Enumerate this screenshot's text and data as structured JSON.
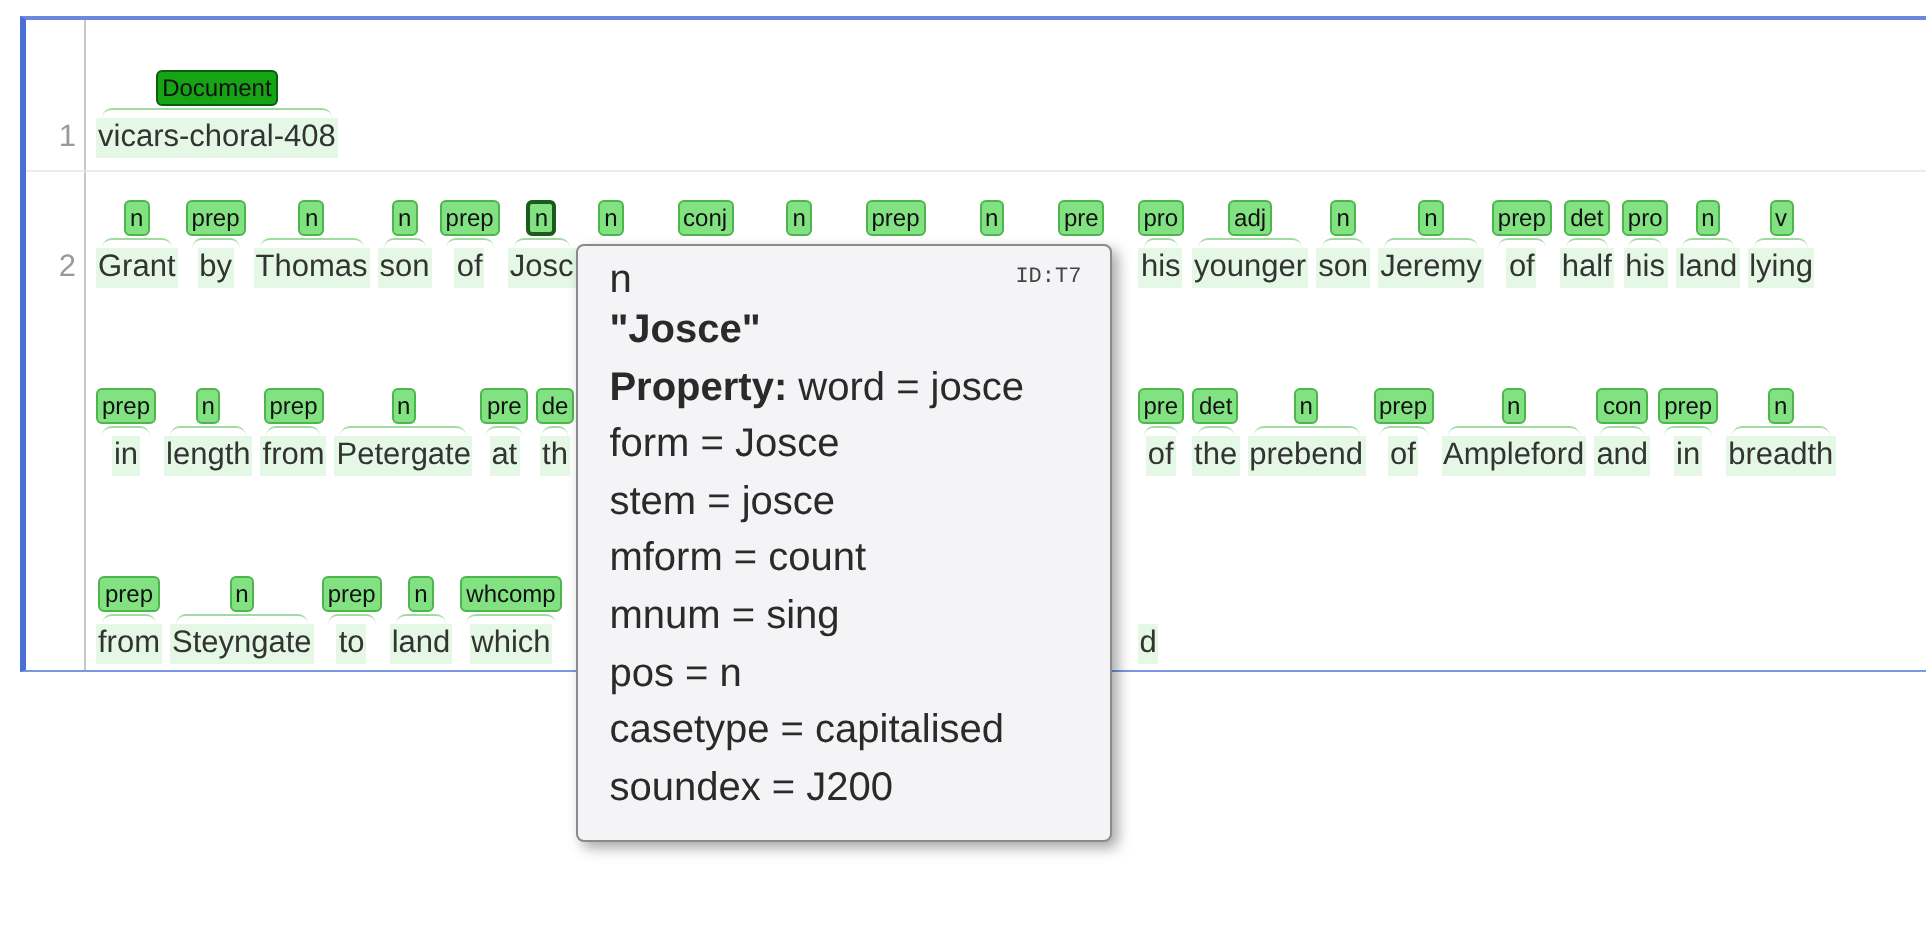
{
  "lines": [
    {
      "number": "1",
      "left": [
        {
          "kind": "document",
          "label": "Document",
          "word": "vicars-choral-408",
          "selected": false
        }
      ]
    },
    {
      "number": "2",
      "left": [
        {
          "kind": "span",
          "label": "n",
          "word": "Grant",
          "selected": false
        },
        {
          "kind": "span",
          "label": "prep",
          "word": "by",
          "selected": false
        },
        {
          "kind": "span",
          "label": "n",
          "word": "Thomas",
          "selected": false
        },
        {
          "kind": "span",
          "label": "n",
          "word": "son",
          "selected": false
        },
        {
          "kind": "span",
          "label": "prep",
          "word": "of",
          "selected": false
        },
        {
          "kind": "span",
          "label": "n",
          "word": "Josc",
          "selected": true
        }
      ],
      "covered": [
        {
          "kind": "span",
          "label": "n",
          "selected": false
        },
        {
          "kind": "span",
          "label": "conj",
          "selected": false
        },
        {
          "kind": "span",
          "label": "n",
          "selected": false
        },
        {
          "kind": "span",
          "label": "prep",
          "selected": false
        },
        {
          "kind": "span",
          "label": "n",
          "selected": false
        },
        {
          "kind": "span",
          "label": "pre",
          "selected": false
        }
      ],
      "right": [
        {
          "kind": "span",
          "label": "pro",
          "word": "his",
          "selected": false
        },
        {
          "kind": "span",
          "label": "adj",
          "word": "younger",
          "selected": false
        },
        {
          "kind": "span",
          "label": "n",
          "word": "son",
          "selected": false
        },
        {
          "kind": "span",
          "label": "n",
          "word": "Jeremy",
          "selected": false
        },
        {
          "kind": "span",
          "label": "prep",
          "word": "of",
          "selected": false
        },
        {
          "kind": "span",
          "label": "det",
          "word": "half",
          "selected": false
        },
        {
          "kind": "span",
          "label": "pro",
          "word": "his",
          "selected": false
        },
        {
          "kind": "span",
          "label": "n",
          "word": "land",
          "selected": false
        },
        {
          "kind": "span",
          "label": "v",
          "word": "lying",
          "selected": false
        }
      ]
    },
    {
      "left": [
        {
          "kind": "span",
          "label": "prep",
          "word": "in",
          "selected": false
        },
        {
          "kind": "span",
          "label": "n",
          "word": "length",
          "selected": false
        },
        {
          "kind": "span",
          "label": "prep",
          "word": "from",
          "selected": false
        },
        {
          "kind": "span",
          "label": "n",
          "word": "Petergate",
          "selected": false
        },
        {
          "kind": "span",
          "label": "pre",
          "word": "at",
          "selected": false
        },
        {
          "kind": "span",
          "label": "de",
          "word": "th",
          "selected": false
        }
      ],
      "right": [
        {
          "kind": "span",
          "label": "pre",
          "word": "of",
          "selected": false
        },
        {
          "kind": "span",
          "label": "det",
          "word": "the",
          "selected": false
        },
        {
          "kind": "span",
          "label": "n",
          "word": "prebend",
          "selected": false
        },
        {
          "kind": "span",
          "label": "prep",
          "word": "of",
          "selected": false
        },
        {
          "kind": "span",
          "label": "n",
          "word": "Ampleford",
          "selected": false
        },
        {
          "kind": "span",
          "label": "con",
          "word": "and",
          "selected": false
        },
        {
          "kind": "span",
          "label": "prep",
          "word": "in",
          "selected": false
        },
        {
          "kind": "span",
          "label": "n",
          "word": "breadth",
          "selected": false
        }
      ]
    },
    {
      "left": [
        {
          "kind": "span",
          "label": "prep",
          "word": "from",
          "selected": false
        },
        {
          "kind": "span",
          "label": "n",
          "word": "Steyngate",
          "selected": false
        },
        {
          "kind": "span",
          "label": "prep",
          "word": "to",
          "selected": false
        },
        {
          "kind": "span",
          "label": "n",
          "word": "land",
          "selected": false
        },
        {
          "kind": "span",
          "label": "whcomp",
          "word": "which",
          "selected": false
        }
      ],
      "right": [
        {
          "kind": "span",
          "word": "d",
          "selected": false
        }
      ]
    }
  ],
  "tooltip": {
    "type": "n",
    "id": "ID:T7",
    "title": "\"Josce\"",
    "property_heading": "Property:",
    "properties": [
      "word = josce",
      "form = Josce",
      "stem = josce",
      "mform = count",
      "mnum = sing",
      "pos = n",
      "casetype = capitalised",
      "soundex = J200"
    ]
  }
}
